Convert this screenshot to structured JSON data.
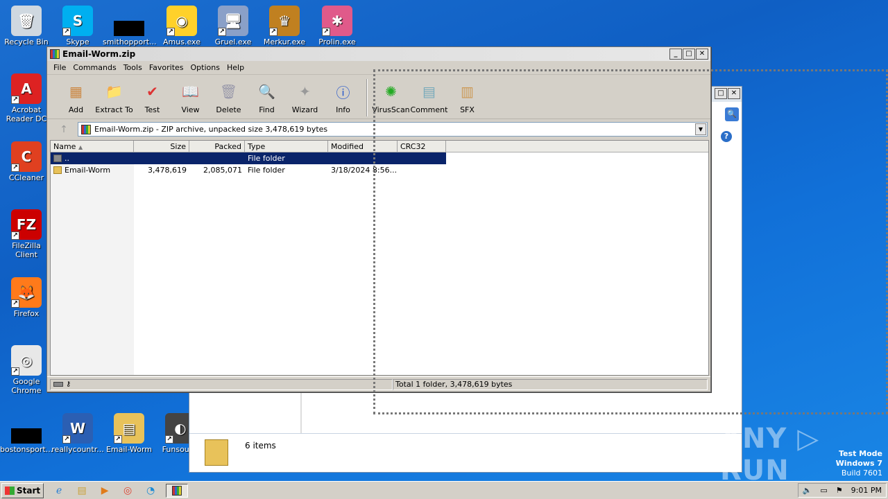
{
  "desktop": {
    "icons": [
      {
        "label": "Recycle Bin",
        "glyph": "🗑",
        "bg": "#cfd8e0"
      },
      {
        "label": "Skype",
        "glyph": "S",
        "bg": "#00aff0"
      },
      {
        "label": "smithopport...",
        "glyph": "",
        "bg": "#000000"
      },
      {
        "label": "Amus.exe",
        "glyph": "◉",
        "bg": "#ffd12a"
      },
      {
        "label": "Gruel.exe",
        "glyph": "🖥",
        "bg": "#8aa0c8"
      },
      {
        "label": "Merkur.exe",
        "glyph": "♛",
        "bg": "#c08020"
      },
      {
        "label": "Prolin.exe",
        "glyph": "✱",
        "bg": "#e05a8a"
      },
      {
        "label": "Acrobat Reader DC",
        "glyph": "A",
        "bg": "#d22"
      },
      {
        "label": "CCleaner",
        "glyph": "C",
        "bg": "#e04020"
      },
      {
        "label": "FileZilla Client",
        "glyph": "FZ",
        "bg": "#c00"
      },
      {
        "label": "Firefox",
        "glyph": "🦊",
        "bg": "#ff7a1a"
      },
      {
        "label": "Google Chrome",
        "glyph": "◎",
        "bg": "#e8e8e8"
      },
      {
        "label": "bostonsport...",
        "glyph": "",
        "bg": "#000000"
      },
      {
        "label": "reallycountr...",
        "glyph": "W",
        "bg": "#2b5fb3"
      },
      {
        "label": "Email-Worm",
        "glyph": "▤",
        "bg": "#e8c25a"
      },
      {
        "label": "Funsoul...",
        "glyph": "◐",
        "bg": "#444"
      }
    ]
  },
  "bg_window": {
    "items_count": "6 items"
  },
  "winrar": {
    "title": "Email-Worm.zip",
    "menu": [
      "File",
      "Commands",
      "Tools",
      "Favorites",
      "Options",
      "Help"
    ],
    "toolbar": [
      {
        "label": "Add",
        "icon": "add-icon",
        "glyph": "▦",
        "color": "#c84"
      },
      {
        "label": "Extract To",
        "icon": "extract-to-icon",
        "glyph": "📁",
        "color": "#6af"
      },
      {
        "label": "Test",
        "icon": "test-icon",
        "glyph": "✔",
        "color": "#d33"
      },
      {
        "label": "View",
        "icon": "view-icon",
        "glyph": "📖",
        "color": "#3a3"
      },
      {
        "label": "Delete",
        "icon": "delete-icon",
        "glyph": "🗑",
        "color": "#99a"
      },
      {
        "label": "Find",
        "icon": "find-icon",
        "glyph": "🔍",
        "color": "#36c"
      },
      {
        "label": "Wizard",
        "icon": "wizard-icon",
        "glyph": "✦",
        "color": "#999"
      },
      {
        "label": "Info",
        "icon": "info-icon",
        "glyph": "ⓘ",
        "color": "#25c"
      },
      {
        "label": "VirusScan",
        "icon": "virusscan-icon",
        "glyph": "✺",
        "color": "#2a2"
      },
      {
        "label": "Comment",
        "icon": "comment-icon",
        "glyph": "▤",
        "color": "#7ab"
      },
      {
        "label": "SFX",
        "icon": "sfx-icon",
        "glyph": "▥",
        "color": "#c95"
      }
    ],
    "address": "Email-Worm.zip - ZIP archive, unpacked size 3,478,619 bytes",
    "columns": [
      "Name",
      "Size",
      "Packed",
      "Type",
      "Modified",
      "CRC32"
    ],
    "rows": [
      {
        "name": "..",
        "size": "",
        "packed": "",
        "type": "File folder",
        "modified": "",
        "crc": "",
        "selected": true
      },
      {
        "name": "Email-Worm",
        "size": "3,478,619",
        "packed": "2,085,071",
        "type": "File folder",
        "modified": "3/18/2024 8:56...",
        "crc": "",
        "selected": false
      }
    ],
    "status": "Total 1 folder, 3,478,619 bytes"
  },
  "taskbar": {
    "start_label": "Start",
    "time": "9:01 PM"
  },
  "watermark": {
    "line1": "Test Mode",
    "line2": "Windows 7",
    "line3": "Build 7601",
    "brand": "ANY ▷ RUN"
  }
}
